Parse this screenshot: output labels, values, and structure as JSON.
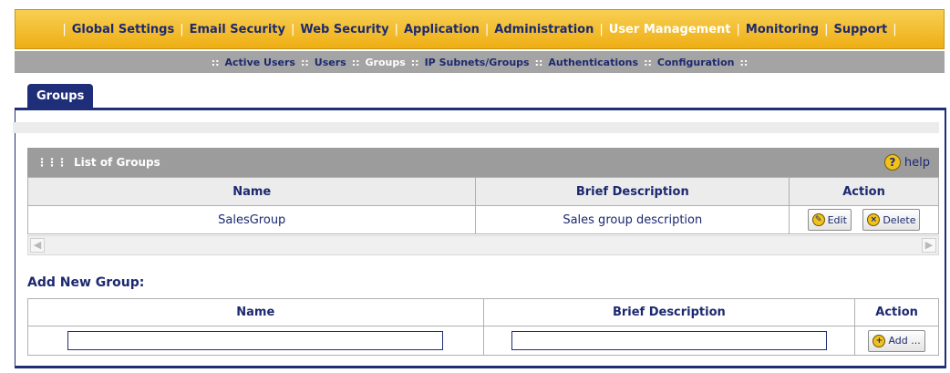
{
  "nav": {
    "items": [
      {
        "label": "Global Settings",
        "active": false
      },
      {
        "label": "Email Security",
        "active": false
      },
      {
        "label": "Web Security",
        "active": false
      },
      {
        "label": "Application",
        "active": false
      },
      {
        "label": "Administration",
        "active": false
      },
      {
        "label": "User Management",
        "active": true
      },
      {
        "label": "Monitoring",
        "active": false
      },
      {
        "label": "Support",
        "active": false
      }
    ],
    "separator": "|"
  },
  "subnav": {
    "items": [
      {
        "label": "Active Users",
        "active": false
      },
      {
        "label": "Users",
        "active": false
      },
      {
        "label": "Groups",
        "active": true
      },
      {
        "label": "IP Subnets/Groups",
        "active": false
      },
      {
        "label": "Authentications",
        "active": false
      },
      {
        "label": "Configuration",
        "active": false
      }
    ],
    "separator": "::"
  },
  "tab": {
    "label": "Groups"
  },
  "list": {
    "title": "List of Groups",
    "help_label": "help",
    "columns": {
      "name": "Name",
      "description": "Brief Description",
      "action": "Action"
    },
    "rows": [
      {
        "name": "SalesGroup",
        "description": "Sales group description",
        "edit_label": "Edit",
        "delete_label": "Delete"
      }
    ]
  },
  "add_group": {
    "title": "Add New Group:",
    "columns": {
      "name": "Name",
      "description": "Brief Description",
      "action": "Action"
    },
    "name_value": "",
    "description_value": "",
    "add_label": "Add ..."
  },
  "colors": {
    "nav_bg": "#f0b524",
    "subnav_bg": "#a4a4a4",
    "accent": "#1f2e78",
    "active_text": "#ffffff"
  }
}
